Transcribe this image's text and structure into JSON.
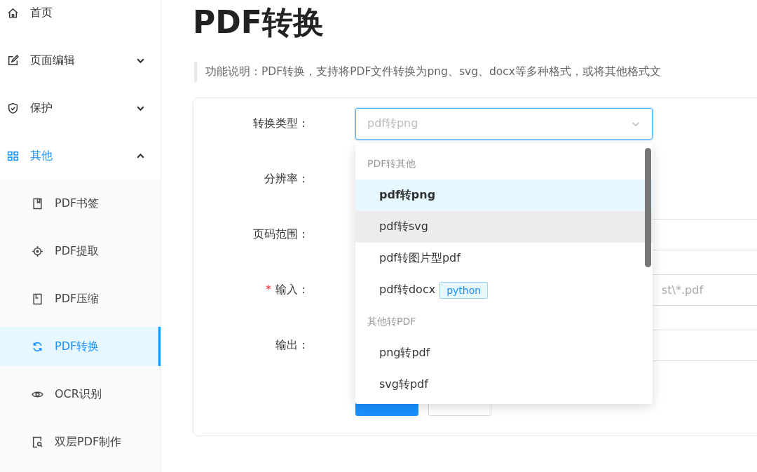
{
  "sidebar": {
    "items": [
      {
        "label": "首页"
      },
      {
        "label": "页面编辑",
        "expanded": false
      },
      {
        "label": "保护",
        "expanded": false
      },
      {
        "label": "其他",
        "expanded": true,
        "children": [
          {
            "label": "PDF书签",
            "selected": false
          },
          {
            "label": "PDF提取",
            "selected": false
          },
          {
            "label": "PDF压缩",
            "selected": false
          },
          {
            "label": "PDF转换",
            "selected": true
          },
          {
            "label": "OCR识别",
            "selected": false
          },
          {
            "label": "双层PDF制作",
            "selected": false
          }
        ]
      }
    ]
  },
  "page": {
    "title": "PDF转换",
    "description": "功能说明：PDF转换，支持将PDF文件转换为png、svg、docx等多种格式，或将其他格式文"
  },
  "form": {
    "fields": [
      {
        "label": "转换类型：",
        "kind": "select",
        "value": "pdf转png"
      },
      {
        "label": "分辨率：",
        "kind": "covered"
      },
      {
        "label": "页码范围：",
        "kind": "text"
      },
      {
        "label": "输入：",
        "kind": "text",
        "required_mark": "*",
        "placeholder": "st\\*.pdf"
      },
      {
        "label": "输出：",
        "kind": "text"
      }
    ],
    "buttons": [
      {
        "kind": "primary"
      },
      {
        "kind": "default"
      }
    ]
  },
  "dropdown": {
    "groups": [
      {
        "title": "PDF转其他",
        "options": [
          {
            "label": "pdf转png",
            "selected": true,
            "hovered": false
          },
          {
            "label": "pdf转svg",
            "selected": false,
            "hovered": true
          },
          {
            "label": "pdf转图片型pdf",
            "selected": false,
            "hovered": false
          },
          {
            "label": "pdf转docx",
            "selected": false,
            "hovered": false,
            "tag": "python"
          }
        ]
      },
      {
        "title": "其他转PDF",
        "options": [
          {
            "label": "png转pdf",
            "selected": false,
            "hovered": false
          },
          {
            "label": "svg转pdf",
            "selected": false,
            "hovered": false
          }
        ]
      }
    ]
  }
}
